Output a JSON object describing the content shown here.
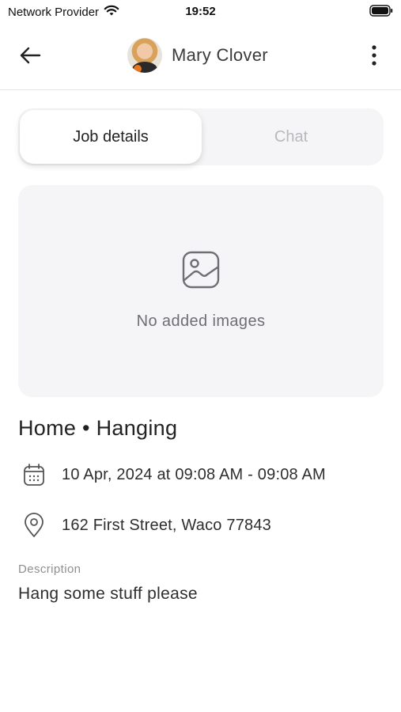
{
  "status_bar": {
    "carrier": "Network Provider",
    "time": "19:52",
    "wifi_icon": "wifi-icon",
    "battery_icon": "battery-icon"
  },
  "header": {
    "back_icon": "arrow-left-icon",
    "name": "Mary Clover",
    "more_icon": "more-vertical-icon"
  },
  "tabs": [
    {
      "label": "Job details",
      "active": true
    },
    {
      "label": "Chat",
      "active": false
    }
  ],
  "images": {
    "icon": "image-icon",
    "empty_text": "No added images"
  },
  "job": {
    "title": "Home • Hanging",
    "date_icon": "calendar-icon",
    "date": "10 Apr, 2024 at 09:08 AM - 09:08 AM",
    "address_icon": "location-pin-icon",
    "address": "162 First Street, Waco 77843",
    "description_label": "Description",
    "description": "Hang some stuff please"
  },
  "colors": {
    "card_background": "#f5f5f7",
    "inactive_tab_text": "#b9b9bd",
    "muted_text": "#8e8e93"
  }
}
